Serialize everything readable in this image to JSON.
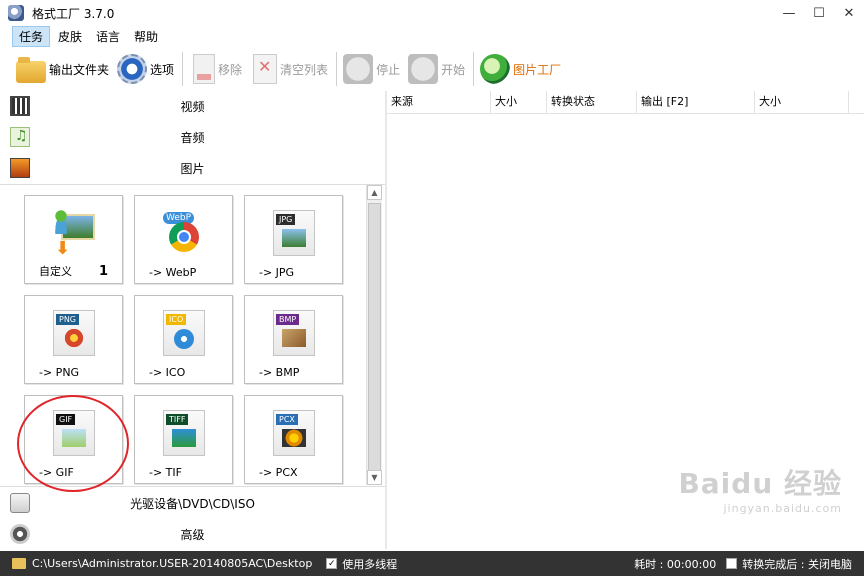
{
  "window": {
    "title": "格式工厂 3.7.0",
    "minimize": "—",
    "maximize": "☐",
    "close": "✕"
  },
  "menu": [
    "任务",
    "皮肤",
    "语言",
    "帮助"
  ],
  "toolbar": {
    "output_folder": "输出文件夹",
    "options": "选项",
    "remove": "移除",
    "clear_list": "清空列表",
    "stop": "停止",
    "start": "开始",
    "picture_factory": "图片工厂"
  },
  "categories": {
    "video": "视频",
    "audio": "音频",
    "image": "图片",
    "disc": "光驱设备\\DVD\\CD\\ISO",
    "advanced": "高级"
  },
  "tiles": [
    {
      "label": "自定义",
      "count": "1"
    },
    {
      "label": "-> WebP",
      "badge": "WebP"
    },
    {
      "label": "-> JPG",
      "badge": "JPG"
    },
    {
      "label": "-> PNG",
      "badge": "PNG"
    },
    {
      "label": "-> ICO",
      "badge": "ICO"
    },
    {
      "label": "-> BMP",
      "badge": "BMP"
    },
    {
      "label": "-> GIF",
      "badge": "GIF"
    },
    {
      "label": "-> TIF",
      "badge": "TIFF"
    },
    {
      "label": "-> PCX",
      "badge": "PCX"
    }
  ],
  "list_columns": [
    "来源",
    "大小",
    "转换状态",
    "输出 [F2]",
    "大小"
  ],
  "status": {
    "path": "C:\\Users\\Administrator.USER-20140805AC\\Desktop",
    "multithread": "使用多线程",
    "elapsed": "耗时 : 00:00:00",
    "after_done": "转换完成后 : 关闭电脑"
  },
  "watermark": {
    "logo": "Baidu 经验",
    "url": "jingyan.baidu.com"
  },
  "colors": {
    "accent_orange": "#e06a00",
    "annotation_red": "#e0262a",
    "statusbar": "#333333"
  }
}
